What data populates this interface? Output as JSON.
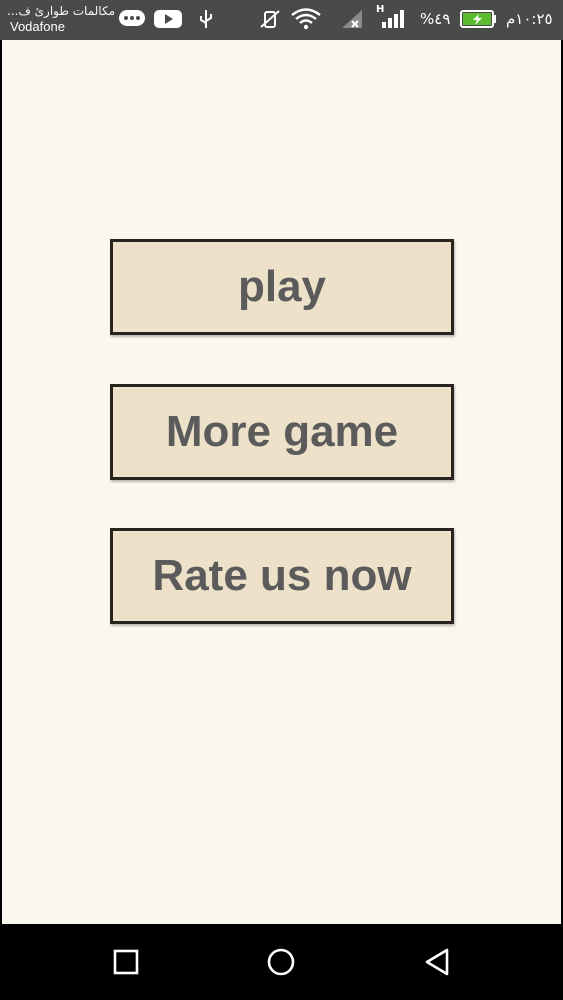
{
  "status_bar": {
    "notification_text": "مكالمات طوارئ ف...",
    "carrier": "Vodafone",
    "battery_percent": "%٤٩",
    "time": "١٠:٢٥م",
    "network_type": "H",
    "icons": [
      "chat-bubble-icon",
      "youtube-icon",
      "usb-icon",
      "vibrate-off-icon",
      "wifi-icon",
      "no-sim-signal-icon",
      "signal-icon",
      "battery-charging-icon"
    ]
  },
  "menu": {
    "play_label": "play",
    "more_games_label": "More game",
    "rate_label": "Rate us now"
  },
  "navigation": {
    "icons": [
      "recent-apps-icon",
      "home-icon",
      "back-icon"
    ]
  }
}
